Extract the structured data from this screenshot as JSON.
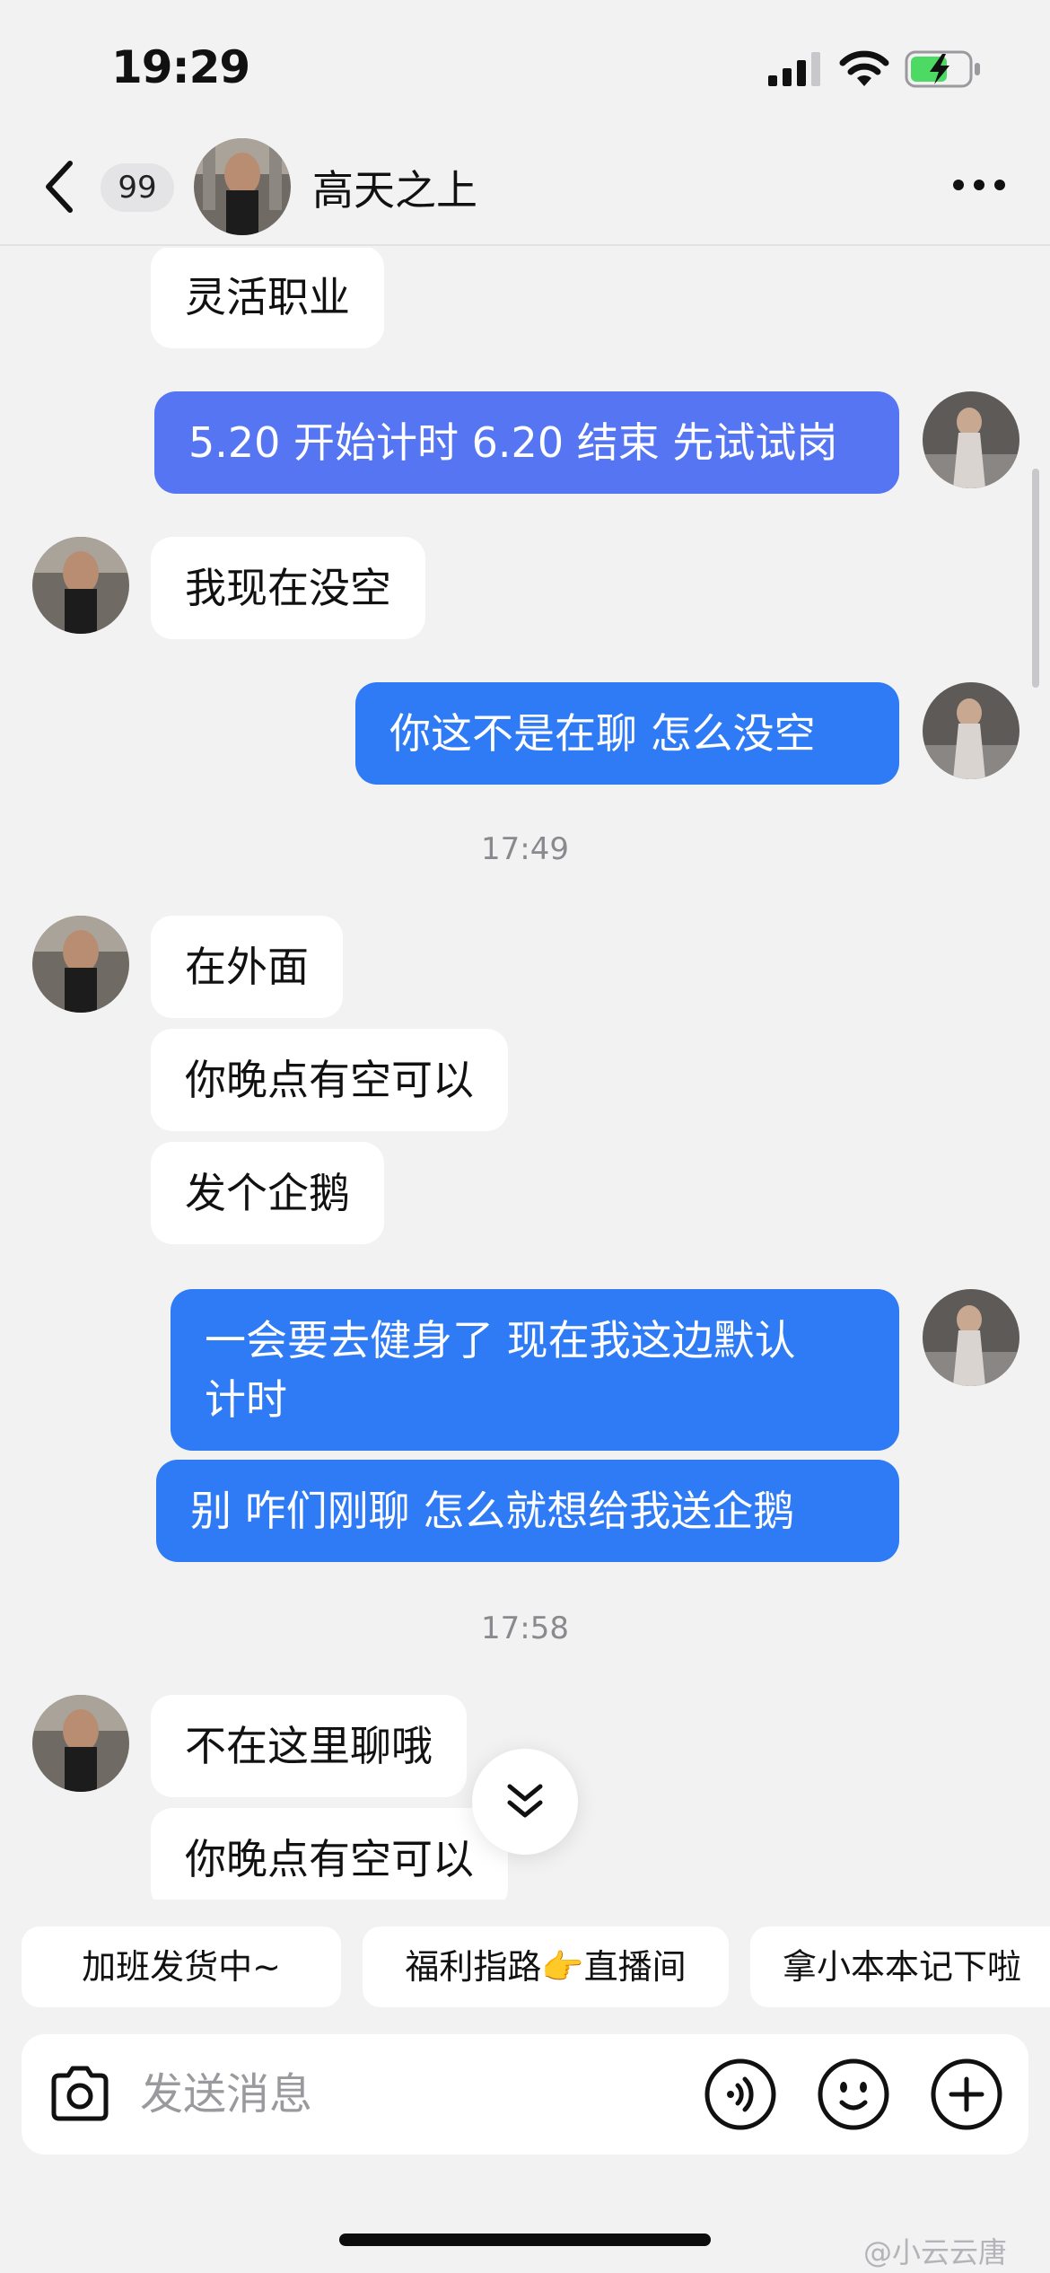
{
  "status_bar": {
    "time": "19:29"
  },
  "header": {
    "unread_count": "99",
    "contact_name": "高天之上"
  },
  "messages": [
    {
      "side": "in",
      "text": "灵活职业"
    },
    {
      "side": "out",
      "text": "5.20 开始计时 6.20 结束 先试试岗"
    },
    {
      "side": "in",
      "text": "我现在没空"
    },
    {
      "side": "out",
      "text": "你这不是在聊 怎么没空"
    },
    {
      "type": "time",
      "text": "17:49"
    },
    {
      "side": "in",
      "text": "在外面"
    },
    {
      "side": "in",
      "text": "你晚点有空可以"
    },
    {
      "side": "in",
      "text": "发个企鹅"
    },
    {
      "side": "out",
      "text": "一会要去健身了 现在我这边默认\n计时"
    },
    {
      "side": "out",
      "text": "别 咋们刚聊 怎么就想给我送企鹅"
    },
    {
      "type": "time",
      "text": "17:58"
    },
    {
      "side": "in",
      "text": "不在这里聊哦"
    },
    {
      "side": "in",
      "text": "你晚点有空可以"
    }
  ],
  "quick_replies": [
    "加班发货中~",
    "福利指路👉直播间",
    "拿小本本记下啦"
  ],
  "input": {
    "placeholder": "发送消息"
  },
  "watermark": "@小云云唐",
  "colors": {
    "outgoing_bubble": "#2f7bf6",
    "incoming_bubble": "#ffffff",
    "background": "#f2f2f3"
  },
  "icons": [
    "back-icon",
    "more-icon",
    "camera-icon",
    "voice-icon",
    "emoji-icon",
    "plus-icon",
    "double-chevron-down-icon"
  ]
}
